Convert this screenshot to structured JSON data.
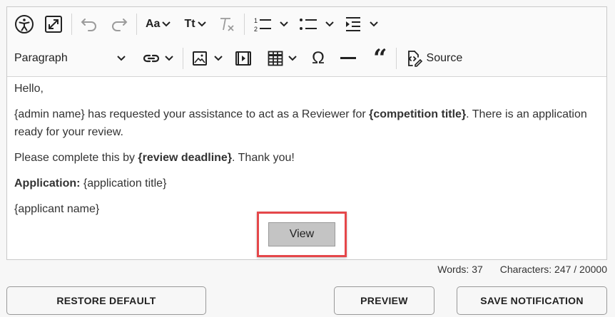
{
  "toolbar": {
    "paragraph_label": "Paragraph",
    "source_label": "Source",
    "icons": [
      "accessibility-icon",
      "fullscreen-icon",
      "undo-icon",
      "redo-icon",
      "font-size-icon",
      "text-case-icon",
      "remove-format-icon",
      "numbered-list-icon",
      "bulleted-list-icon",
      "indent-icon",
      "link-icon",
      "image-icon",
      "media-icon",
      "table-icon",
      "special-characters-icon",
      "horizontal-line-icon",
      "blockquote-icon",
      "source-icon"
    ]
  },
  "content": {
    "greeting": "Hello,",
    "line1_a": "{admin name} has requested your assistance to act as a Reviewer for ",
    "line1_bold": "{competition title}",
    "line1_b": ". There is an application ready for your review.",
    "line2_a": "Please complete this by ",
    "line2_bold": "{review deadline}",
    "line2_b": ". Thank you!",
    "app_label": "Application:",
    "app_value": " {application title}",
    "applicant": "{applicant name}",
    "view_label": "View"
  },
  "status": {
    "words": "Words: 37",
    "characters": "Characters: 247 / 20000"
  },
  "buttons": {
    "restore": "RESTORE DEFAULT",
    "preview": "PREVIEW",
    "save": "SAVE NOTIFICATION"
  },
  "colors": {
    "highlight": "#e5474a",
    "view_bg": "#c4c4c4"
  }
}
